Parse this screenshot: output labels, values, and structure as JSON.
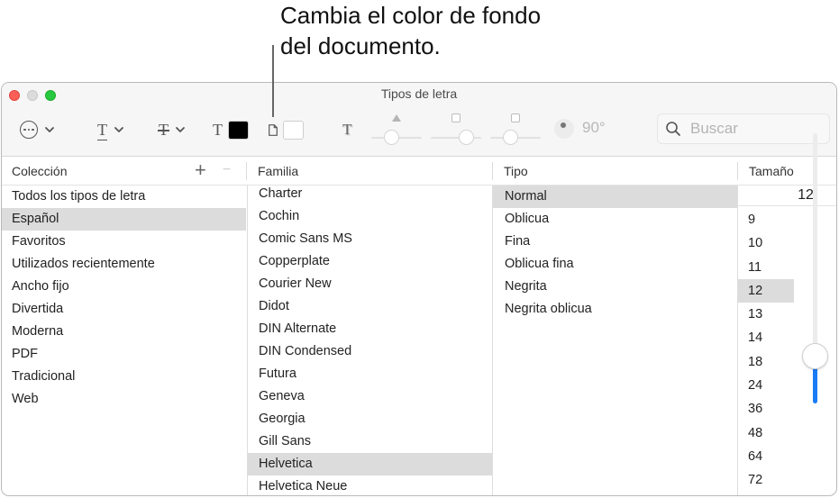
{
  "callout": {
    "line1": "Cambia el color de fondo",
    "line2": "del documento."
  },
  "window": {
    "title": "Tipos de letra",
    "traffic_lights": [
      "close",
      "minimize",
      "maximize"
    ]
  },
  "toolbar": {
    "actions_icon": "ellipsis-circle-icon",
    "underline_icon": "underline-T-icon",
    "strikethrough_icon": "strikethrough-T-icon",
    "text_color_icon": "text-color-T-icon",
    "text_color": "#000000",
    "document_color_icon": "document-icon",
    "document_color": "#ffffff",
    "shadow_icon": "text-shadow-T-icon",
    "shadow_sliders": [
      {
        "name": "opacity",
        "marker": "triangle",
        "value": 0.35
      },
      {
        "name": "blur",
        "marker": "square",
        "value": 0.8
      },
      {
        "name": "offset",
        "marker": "square",
        "value": 0.35
      }
    ],
    "angle_value": "90°",
    "search": {
      "placeholder": "Buscar",
      "value": ""
    }
  },
  "columns": {
    "collection": {
      "header": "Colección",
      "add_label": "+",
      "remove_label": "−",
      "items": [
        "Todos los tipos de letra",
        "Español",
        "Favoritos",
        "Utilizados recientemente",
        "Ancho fijo",
        "Divertida",
        "Moderna",
        "PDF",
        "Tradicional",
        "Web"
      ],
      "selected": "Español"
    },
    "family": {
      "header": "Familia",
      "items": [
        "Charter",
        "Cochin",
        "Comic Sans MS",
        "Copperplate",
        "Courier New",
        "Didot",
        "DIN Alternate",
        "DIN Condensed",
        "Futura",
        "Geneva",
        "Georgia",
        "Gill Sans",
        "Helvetica",
        "Helvetica Neue"
      ],
      "selected": "Helvetica"
    },
    "typeface": {
      "header": "Tipo",
      "items": [
        "Normal",
        "Oblicua",
        "Fina",
        "Oblicua fina",
        "Negrita",
        "Negrita oblicua"
      ],
      "selected": "Normal"
    },
    "size": {
      "header": "Tamaño",
      "value": "12",
      "items": [
        "9",
        "10",
        "11",
        "12",
        "13",
        "14",
        "18",
        "24",
        "36",
        "48",
        "64",
        "72"
      ],
      "selected": "12",
      "slider_fraction": 0.15
    }
  }
}
